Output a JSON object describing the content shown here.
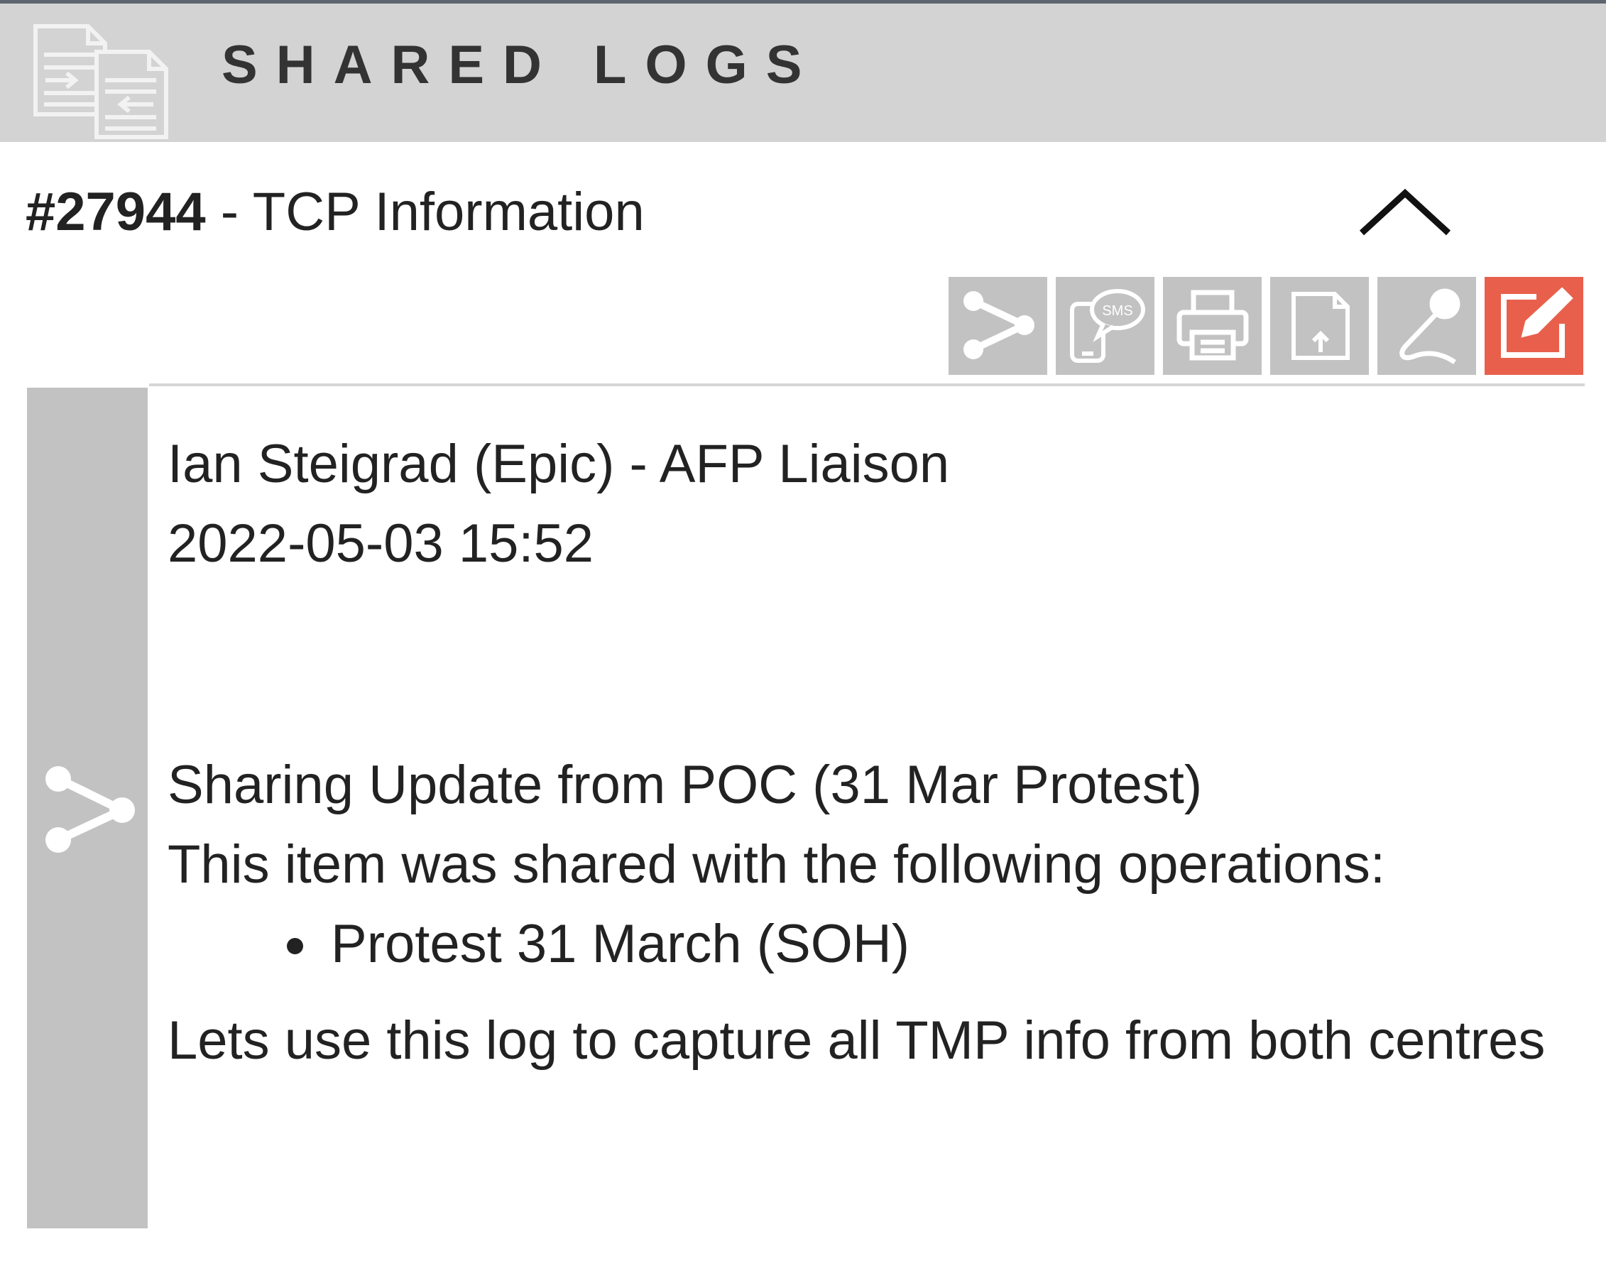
{
  "header": {
    "title": "SHARED LOGS",
    "icon": "shared-documents-icon"
  },
  "log": {
    "id": "#27944",
    "separator": " - ",
    "title": "TCP Information",
    "collapse_icon": "chevron-up-icon"
  },
  "toolbar": {
    "buttons": [
      {
        "icon": "share-icon"
      },
      {
        "icon": "sms-icon",
        "icon_text": "SMS"
      },
      {
        "icon": "print-icon"
      },
      {
        "icon": "document-export-icon"
      },
      {
        "icon": "microphone-icon"
      },
      {
        "icon": "edit-icon"
      }
    ],
    "edit_color": "#e8604c",
    "button_color": "#c2c2c2"
  },
  "entry": {
    "author": "Ian Steigrad (Epic) - AFP Liaison",
    "timestamp": "2022-05-03 15:52",
    "share_title": "Sharing Update from POC (31 Mar Protest)",
    "share_intro": "This item was shared with the following operations:",
    "operations": [
      "Protest 31 March (SOH)"
    ],
    "note": "Lets use this log to capture all TMP info from both centres",
    "type_icon": "share-icon"
  }
}
